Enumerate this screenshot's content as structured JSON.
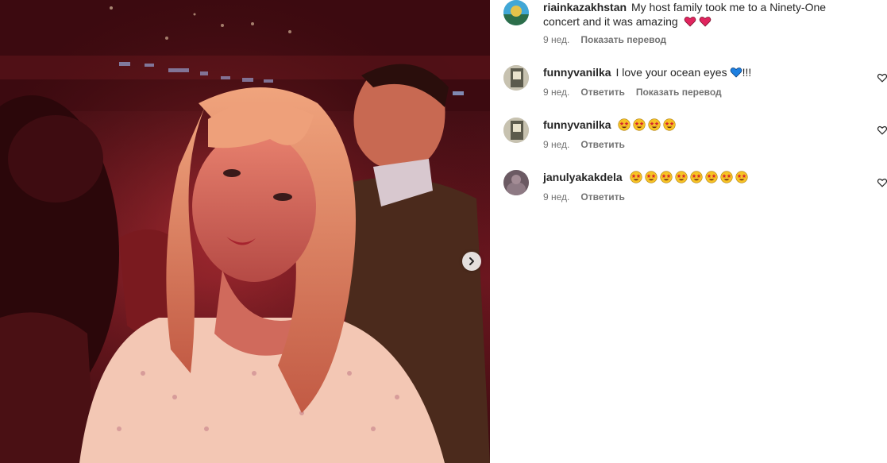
{
  "post": {
    "next_icon": "chevron-right-icon"
  },
  "comments": [
    {
      "username": "riainkazakhstan",
      "text": "My host family took me to a Ninety-One concert and it was amazing",
      "emojis": [
        "red-heart",
        "red-heart"
      ],
      "age": "9 нед.",
      "actions": [
        "Показать перевод"
      ],
      "has_like": false
    },
    {
      "username": "funnyvanilka",
      "text": "I love your ocean eyes",
      "emojis": [
        "blue-heart"
      ],
      "suffix": "!!!",
      "age": "9 нед.",
      "actions": [
        "Ответить",
        "Показать перевод"
      ],
      "has_like": true
    },
    {
      "username": "funnyvanilka",
      "text": "",
      "emojis": [
        "star-struck",
        "star-struck",
        "star-struck",
        "star-struck"
      ],
      "age": "9 нед.",
      "actions": [
        "Ответить"
      ],
      "has_like": true
    },
    {
      "username": "janulyakakdela",
      "text": "",
      "emojis": [
        "star-struck",
        "star-struck",
        "star-struck",
        "star-struck",
        "star-struck",
        "star-struck",
        "star-struck",
        "star-struck"
      ],
      "age": "9 нед.",
      "actions": [
        "Ответить"
      ],
      "has_like": true
    }
  ],
  "colors": {
    "text": "#262626",
    "secondary": "#737373",
    "red_heart": "#e0245e",
    "blue_heart": "#1d7fe0",
    "emoji_face": "#f7c325"
  }
}
